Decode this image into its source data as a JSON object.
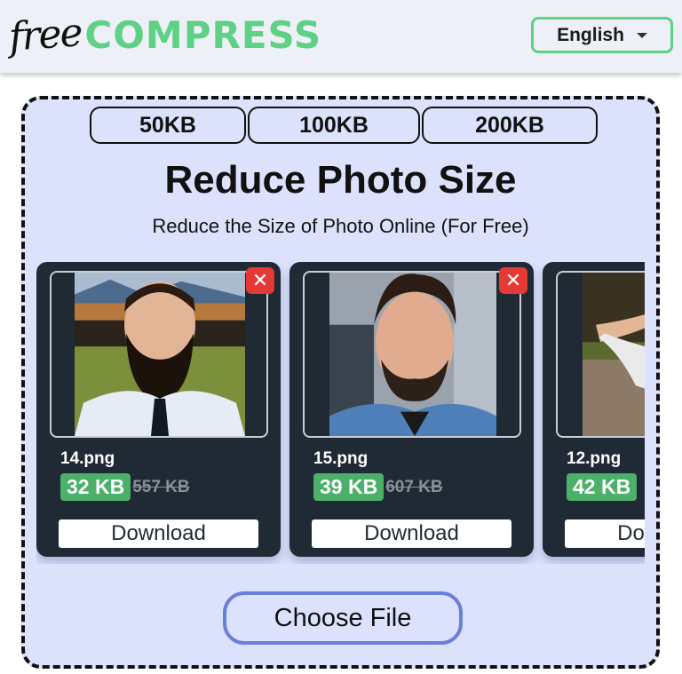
{
  "header": {
    "logo_free": "free",
    "logo_compress": "COMPRESS",
    "language": {
      "selected": "English",
      "icon": "caret-down-icon"
    }
  },
  "size_presets": [
    {
      "label": "50KB"
    },
    {
      "label": "100KB"
    },
    {
      "label": "200KB"
    }
  ],
  "hero": {
    "title": "Reduce Photo Size",
    "subtitle": "Reduce the Size of Photo Online (For Free)"
  },
  "files": [
    {
      "name": "14.png",
      "compressed_size": "32 KB",
      "original_size": "557 KB",
      "download_label": "Download",
      "remove_icon": "✕"
    },
    {
      "name": "15.png",
      "compressed_size": "39 KB",
      "original_size": "607 KB",
      "download_label": "Download",
      "remove_icon": "✕"
    },
    {
      "name": "12.png",
      "compressed_size": "42 KB",
      "original_size": "",
      "download_label": "Download",
      "remove_icon": "✕"
    }
  ],
  "choose_file": {
    "label": "Choose File"
  },
  "colors": {
    "brand_green": "#5ed184",
    "size_badge_green": "#4caf6a",
    "card_dark": "#1f2a35",
    "remove_red": "#e53935",
    "panel_bg": "#dce2fb",
    "choose_border": "#6a7fd9"
  }
}
